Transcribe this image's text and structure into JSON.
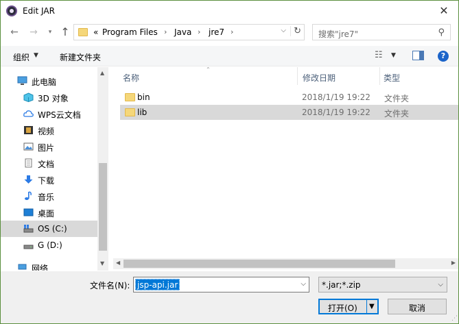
{
  "window": {
    "title": "Edit JAR",
    "close_glyph": "✕"
  },
  "address_bar": {
    "prefix": "«",
    "segments": [
      "Program Files",
      "Java",
      "jre7"
    ],
    "search_placeholder": "搜索\"jre7\""
  },
  "toolbar": {
    "organize_label": "组织",
    "new_folder_label": "新建文件夹"
  },
  "nav_pane": {
    "items": [
      {
        "label": "此电脑",
        "icon": "computer-icon"
      },
      {
        "label": "3D 对象",
        "icon": "3d-objects-icon"
      },
      {
        "label": "WPS云文档",
        "icon": "cloud-icon"
      },
      {
        "label": "视频",
        "icon": "video-icon"
      },
      {
        "label": "图片",
        "icon": "pictures-icon"
      },
      {
        "label": "文档",
        "icon": "documents-icon"
      },
      {
        "label": "下载",
        "icon": "download-icon"
      },
      {
        "label": "音乐",
        "icon": "music-icon"
      },
      {
        "label": "桌面",
        "icon": "desktop-icon"
      },
      {
        "label": "OS (C:)",
        "icon": "drive-c-icon"
      },
      {
        "label": "G (D:)",
        "icon": "drive-d-icon"
      },
      {
        "label": "网络",
        "icon": "network-icon"
      }
    ],
    "selected": "OS (C:)"
  },
  "file_list": {
    "columns": [
      "名称",
      "修改日期",
      "类型"
    ],
    "rows": [
      {
        "name": "bin",
        "date": "2018/1/19 19:22",
        "type": "文件夹"
      },
      {
        "name": "lib",
        "date": "2018/1/19 19:22",
        "type": "文件夹"
      }
    ],
    "selected_row": "lib"
  },
  "bottom": {
    "filename_label": "文件名(N):",
    "filename_value": "jsp-api.jar",
    "filetype_value": "*.jar;*.zip",
    "open_label": "打开(O)",
    "cancel_label": "取消"
  },
  "colors": {
    "accent": "#0078d7",
    "selection": "#d9d9d9",
    "folder": "#f5d77a",
    "window_border": "#5a8f3d"
  }
}
